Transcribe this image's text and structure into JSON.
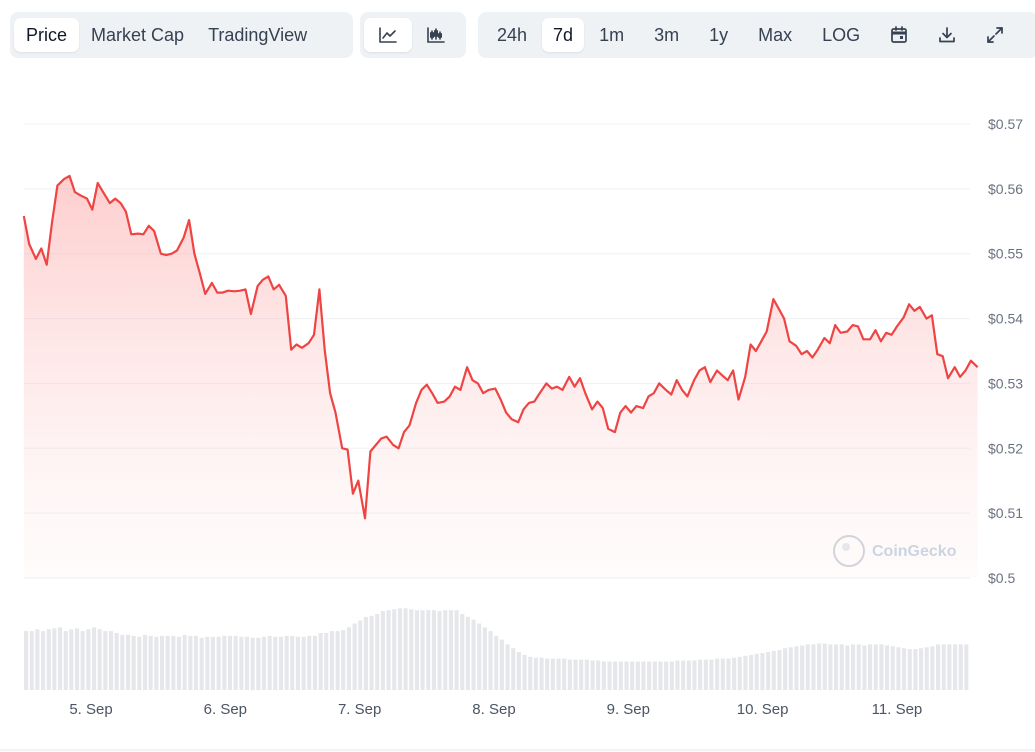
{
  "toolbar": {
    "data_tabs": [
      "Price",
      "Market Cap",
      "TradingView"
    ],
    "active_data_tab": "Price",
    "chart_style_icons": [
      "line-chart-icon",
      "candlestick-chart-icon"
    ],
    "ranges": [
      "24h",
      "7d",
      "1m",
      "3m",
      "1y",
      "Max",
      "LOG"
    ],
    "active_range": "7d",
    "action_icons": [
      "calendar-icon",
      "download-icon",
      "expand-icon"
    ]
  },
  "watermark": "CoinGecko",
  "colors": {
    "line": "#ef4444",
    "fill_top": "#fca5a5",
    "volume": "#e5e7eb",
    "grid": "#eef0f3"
  },
  "chart_data": {
    "type": "area",
    "title": "",
    "xlabel": "",
    "ylabel": "",
    "x_tick_labels": [
      "5. Sep",
      "6. Sep",
      "7. Sep",
      "8. Sep",
      "9. Sep",
      "10. Sep",
      "11. Sep"
    ],
    "y_tick_labels": [
      "$0.57",
      "$0.56",
      "$0.55",
      "$0.54",
      "$0.53",
      "$0.52",
      "$0.51",
      "$0.5"
    ],
    "ylim": [
      0.5,
      0.57
    ],
    "x_range_days": [
      4.5,
      11.5
    ],
    "grid": true,
    "series": [
      {
        "type": "line",
        "points": [
          [
            4.5,
            0.5558
          ],
          [
            4.54,
            0.5515
          ],
          [
            4.59,
            0.5492
          ],
          [
            4.63,
            0.5508
          ],
          [
            4.67,
            0.5483
          ],
          [
            4.71,
            0.5548
          ],
          [
            4.75,
            0.5605
          ],
          [
            4.8,
            0.5615
          ],
          [
            4.84,
            0.562
          ],
          [
            4.88,
            0.5595
          ],
          [
            4.92,
            0.559
          ],
          [
            4.97,
            0.5585
          ],
          [
            5.01,
            0.5568
          ],
          [
            5.05,
            0.5609
          ],
          [
            5.09,
            0.5595
          ],
          [
            5.14,
            0.5578
          ],
          [
            5.18,
            0.5585
          ],
          [
            5.22,
            0.5578
          ],
          [
            5.26,
            0.5565
          ],
          [
            5.3,
            0.553
          ],
          [
            5.35,
            0.5531
          ],
          [
            5.39,
            0.553
          ],
          [
            5.43,
            0.5543
          ],
          [
            5.47,
            0.5535
          ],
          [
            5.52,
            0.55
          ],
          [
            5.56,
            0.5498
          ],
          [
            5.6,
            0.55
          ],
          [
            5.64,
            0.5505
          ],
          [
            5.69,
            0.5525
          ],
          [
            5.73,
            0.5552
          ],
          [
            5.77,
            0.55
          ],
          [
            5.81,
            0.547
          ],
          [
            5.85,
            0.5438
          ],
          [
            5.9,
            0.5455
          ],
          [
            5.94,
            0.544
          ],
          [
            5.98,
            0.544
          ],
          [
            6.02,
            0.5443
          ],
          [
            6.07,
            0.5442
          ],
          [
            6.11,
            0.5443
          ],
          [
            6.15,
            0.5445
          ],
          [
            6.19,
            0.5407
          ],
          [
            6.24,
            0.545
          ],
          [
            6.28,
            0.546
          ],
          [
            6.32,
            0.5465
          ],
          [
            6.36,
            0.5445
          ],
          [
            6.4,
            0.5452
          ],
          [
            6.45,
            0.5435
          ],
          [
            6.49,
            0.5352
          ],
          [
            6.53,
            0.536
          ],
          [
            6.57,
            0.5355
          ],
          [
            6.62,
            0.5362
          ],
          [
            6.66,
            0.5375
          ],
          [
            6.7,
            0.5445
          ],
          [
            6.74,
            0.5352
          ],
          [
            6.78,
            0.5285
          ],
          [
            6.82,
            0.5255
          ],
          [
            6.87,
            0.52
          ],
          [
            6.91,
            0.5198
          ],
          [
            6.95,
            0.513
          ],
          [
            6.99,
            0.515
          ],
          [
            7.04,
            0.5092
          ],
          [
            7.08,
            0.5195
          ],
          [
            7.12,
            0.5205
          ],
          [
            7.16,
            0.5215
          ],
          [
            7.2,
            0.5218
          ],
          [
            7.25,
            0.5205
          ],
          [
            7.29,
            0.52
          ],
          [
            7.33,
            0.5225
          ],
          [
            7.37,
            0.5235
          ],
          [
            7.42,
            0.527
          ],
          [
            7.46,
            0.529
          ],
          [
            7.5,
            0.5298
          ],
          [
            7.54,
            0.5285
          ],
          [
            7.58,
            0.527
          ],
          [
            7.63,
            0.5272
          ],
          [
            7.67,
            0.528
          ],
          [
            7.71,
            0.5295
          ],
          [
            7.75,
            0.529
          ],
          [
            7.8,
            0.5325
          ],
          [
            7.84,
            0.5305
          ],
          [
            7.88,
            0.53
          ],
          [
            7.92,
            0.5285
          ],
          [
            7.96,
            0.529
          ],
          [
            8.01,
            0.5292
          ],
          [
            8.05,
            0.5275
          ],
          [
            8.09,
            0.5255
          ],
          [
            8.13,
            0.5245
          ],
          [
            8.18,
            0.524
          ],
          [
            8.22,
            0.526
          ],
          [
            8.26,
            0.527
          ],
          [
            8.3,
            0.5272
          ],
          [
            8.34,
            0.5285
          ],
          [
            8.39,
            0.53
          ],
          [
            8.43,
            0.5292
          ],
          [
            8.47,
            0.5295
          ],
          [
            8.51,
            0.529
          ],
          [
            8.56,
            0.531
          ],
          [
            8.6,
            0.5295
          ],
          [
            8.64,
            0.5308
          ],
          [
            8.68,
            0.5285
          ],
          [
            8.73,
            0.526
          ],
          [
            8.77,
            0.5272
          ],
          [
            8.81,
            0.5262
          ],
          [
            8.85,
            0.523
          ],
          [
            8.9,
            0.5225
          ],
          [
            8.94,
            0.5255
          ],
          [
            8.98,
            0.5265
          ],
          [
            9.02,
            0.5255
          ],
          [
            9.06,
            0.5265
          ],
          [
            9.11,
            0.5262
          ],
          [
            9.15,
            0.528
          ],
          [
            9.19,
            0.5285
          ],
          [
            9.23,
            0.53
          ],
          [
            9.28,
            0.529
          ],
          [
            9.32,
            0.5283
          ],
          [
            9.36,
            0.5305
          ],
          [
            9.4,
            0.529
          ],
          [
            9.44,
            0.528
          ],
          [
            9.49,
            0.5305
          ],
          [
            9.53,
            0.532
          ],
          [
            9.57,
            0.5325
          ],
          [
            9.61,
            0.5302
          ],
          [
            9.66,
            0.532
          ],
          [
            9.7,
            0.5312
          ],
          [
            9.74,
            0.5305
          ],
          [
            9.78,
            0.532
          ],
          [
            9.82,
            0.5275
          ],
          [
            9.87,
            0.531
          ],
          [
            9.91,
            0.536
          ],
          [
            9.95,
            0.535
          ],
          [
            9.99,
            0.5365
          ],
          [
            10.03,
            0.538
          ],
          [
            10.08,
            0.543
          ],
          [
            10.12,
            0.5415
          ],
          [
            10.16,
            0.54
          ],
          [
            10.2,
            0.5365
          ],
          [
            10.25,
            0.5358
          ],
          [
            10.29,
            0.5345
          ],
          [
            10.33,
            0.535
          ],
          [
            10.37,
            0.534
          ],
          [
            10.41,
            0.5352
          ],
          [
            10.46,
            0.537
          ],
          [
            10.5,
            0.5362
          ],
          [
            10.54,
            0.539
          ],
          [
            10.58,
            0.5378
          ],
          [
            10.63,
            0.538
          ],
          [
            10.67,
            0.539
          ],
          [
            10.71,
            0.5388
          ],
          [
            10.75,
            0.5368
          ],
          [
            10.8,
            0.5368
          ],
          [
            10.84,
            0.5382
          ],
          [
            10.88,
            0.5365
          ],
          [
            10.92,
            0.5378
          ],
          [
            10.96,
            0.5375
          ],
          [
            11.0,
            0.5388
          ],
          [
            11.05,
            0.5402
          ],
          [
            11.09,
            0.5422
          ],
          [
            11.13,
            0.5412
          ],
          [
            11.17,
            0.5418
          ],
          [
            11.22,
            0.54
          ],
          [
            11.26,
            0.5405
          ],
          [
            11.3,
            0.5345
          ],
          [
            11.34,
            0.5342
          ],
          [
            11.38,
            0.5308
          ],
          [
            11.43,
            0.5325
          ],
          [
            11.47,
            0.531
          ],
          [
            11.51,
            0.532
          ],
          [
            11.55,
            0.5335
          ],
          [
            11.6,
            0.5325
          ]
        ]
      }
    ],
    "volume_relative": [
      0.62,
      0.62,
      0.64,
      0.62,
      0.64,
      0.65,
      0.66,
      0.62,
      0.64,
      0.65,
      0.62,
      0.64,
      0.66,
      0.64,
      0.62,
      0.62,
      0.6,
      0.58,
      0.58,
      0.57,
      0.56,
      0.58,
      0.57,
      0.56,
      0.57,
      0.57,
      0.57,
      0.56,
      0.58,
      0.57,
      0.57,
      0.55,
      0.56,
      0.56,
      0.56,
      0.57,
      0.57,
      0.57,
      0.56,
      0.56,
      0.55,
      0.55,
      0.56,
      0.57,
      0.56,
      0.56,
      0.57,
      0.57,
      0.56,
      0.56,
      0.57,
      0.57,
      0.6,
      0.6,
      0.62,
      0.62,
      0.63,
      0.66,
      0.7,
      0.73,
      0.77,
      0.78,
      0.8,
      0.83,
      0.84,
      0.85,
      0.86,
      0.86,
      0.85,
      0.84,
      0.84,
      0.84,
      0.84,
      0.83,
      0.84,
      0.84,
      0.84,
      0.8,
      0.77,
      0.74,
      0.7,
      0.66,
      0.62,
      0.57,
      0.53,
      0.48,
      0.44,
      0.4,
      0.37,
      0.35,
      0.34,
      0.34,
      0.33,
      0.33,
      0.33,
      0.33,
      0.32,
      0.32,
      0.32,
      0.32,
      0.31,
      0.31,
      0.3,
      0.3,
      0.3,
      0.3,
      0.3,
      0.3,
      0.3,
      0.3,
      0.3,
      0.3,
      0.3,
      0.3,
      0.3,
      0.31,
      0.31,
      0.31,
      0.31,
      0.32,
      0.32,
      0.32,
      0.33,
      0.33,
      0.33,
      0.34,
      0.35,
      0.36,
      0.37,
      0.38,
      0.39,
      0.4,
      0.41,
      0.42,
      0.44,
      0.45,
      0.46,
      0.47,
      0.48,
      0.48,
      0.49,
      0.49,
      0.48,
      0.48,
      0.48,
      0.47,
      0.48,
      0.48,
      0.47,
      0.48,
      0.48,
      0.48,
      0.47,
      0.46,
      0.45,
      0.44,
      0.43,
      0.43,
      0.44,
      0.45,
      0.46,
      0.48,
      0.48,
      0.48,
      0.48,
      0.48,
      0.48
    ]
  }
}
